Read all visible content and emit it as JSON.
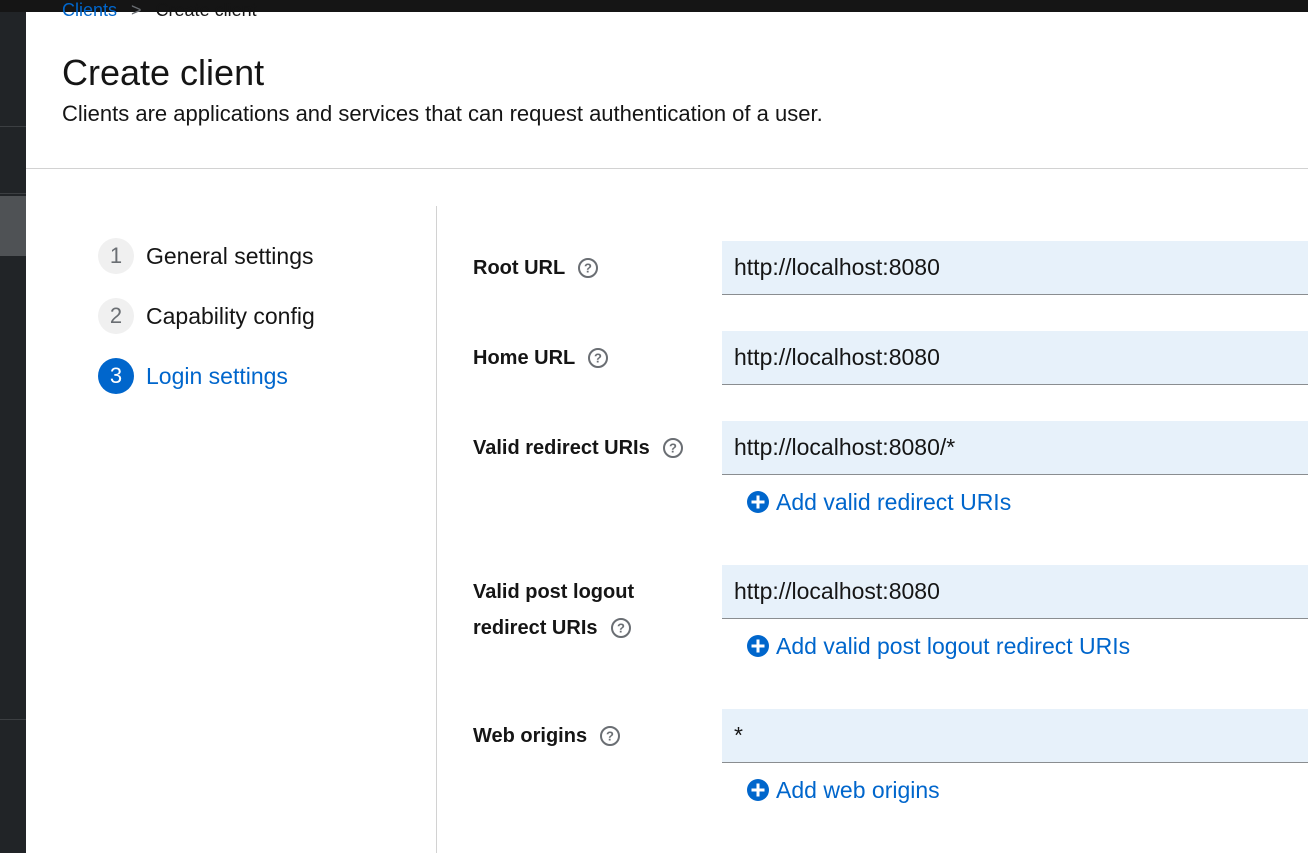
{
  "breadcrumb": {
    "parent": "Clients",
    "separator": ">",
    "current": "Create client"
  },
  "page": {
    "title": "Create client",
    "description": "Clients are applications and services that can request authentication of a user."
  },
  "wizard": {
    "steps": [
      {
        "number": "1",
        "label": "General settings",
        "current": false
      },
      {
        "number": "2",
        "label": "Capability config",
        "current": false
      },
      {
        "number": "3",
        "label": "Login settings",
        "current": true
      }
    ]
  },
  "form": {
    "root_url": {
      "label": "Root URL",
      "value": "http://localhost:8080"
    },
    "home_url": {
      "label": "Home URL",
      "value": "http://localhost:8080"
    },
    "valid_redirect_uris": {
      "label": "Valid redirect URIs",
      "value": "http://localhost:8080/*",
      "add_label": "Add valid redirect URIs"
    },
    "valid_post_logout_redirect_uris": {
      "label_line1": "Valid post logout",
      "label_line2": "redirect URIs",
      "value": "http://localhost:8080",
      "add_label": "Add valid post logout redirect URIs"
    },
    "web_origins": {
      "label": "Web origins",
      "value": "*",
      "add_label": "Add web origins"
    }
  },
  "colors": {
    "accent": "#0066cc",
    "input_bg": "#e7f1fa",
    "sidebar_bg": "#212427"
  },
  "icons": {
    "help": "question-circle-icon",
    "add": "plus-circle-icon"
  }
}
